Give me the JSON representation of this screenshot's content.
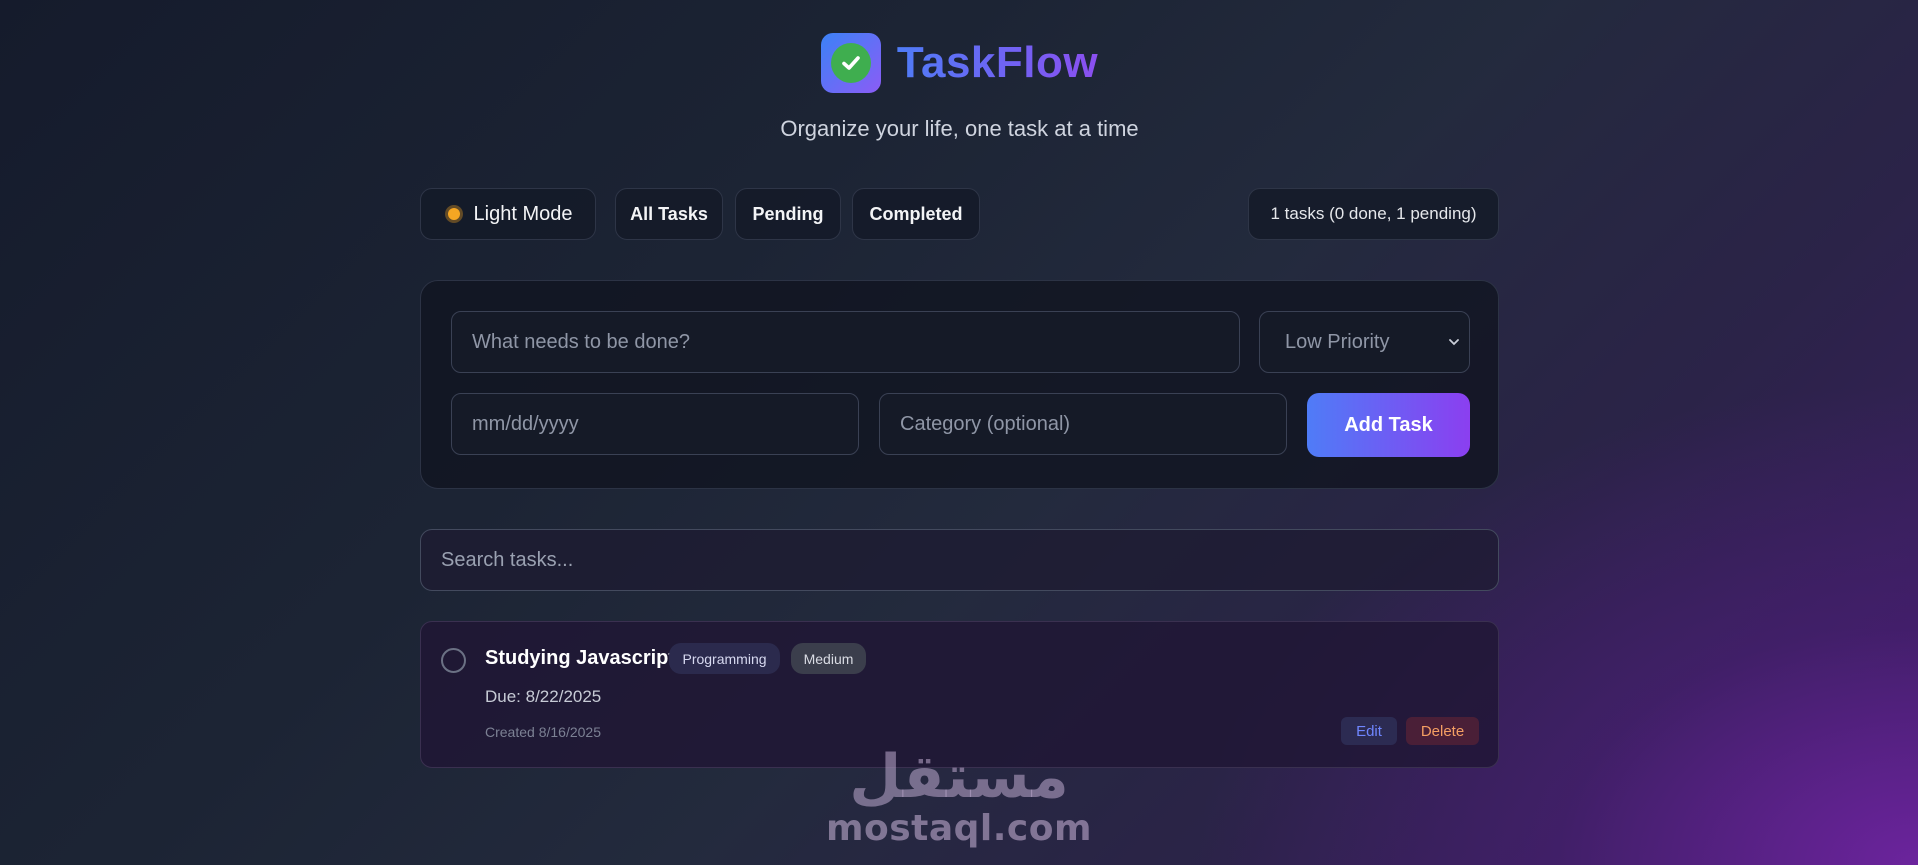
{
  "header": {
    "app_name": "TaskFlow",
    "tagline": "Organize your life, one task at a time",
    "logo_icon": "check-circle-icon"
  },
  "toolbar": {
    "theme_toggle_label": "Light Mode",
    "theme_icon": "sun-icon",
    "filters": [
      "All Tasks",
      "Pending",
      "Completed"
    ],
    "stats_text": "1 tasks (0 done, 1 pending)"
  },
  "form": {
    "task_placeholder": "What needs to be done?",
    "priority_selected": "Low Priority",
    "date_placeholder": "mm/dd/yyyy",
    "category_placeholder": "Category (optional)",
    "add_button_label": "Add Task"
  },
  "search": {
    "placeholder": "Search tasks..."
  },
  "tasks": [
    {
      "title": "Studying Javascript",
      "category": "Programming",
      "priority": "Medium",
      "due": "Due: 8/22/2025",
      "created": "Created 8/16/2025",
      "completed": false,
      "edit_label": "Edit",
      "delete_label": "Delete"
    }
  ],
  "watermark": {
    "arabic": "مستقل",
    "latin": "mostaql.com"
  },
  "colors": {
    "accent_blue": "#4f7cf7",
    "accent_purple": "#8b3ff0",
    "check_green": "#3fae4f",
    "edit_text": "#6f86ff",
    "delete_text": "#f59f63"
  }
}
